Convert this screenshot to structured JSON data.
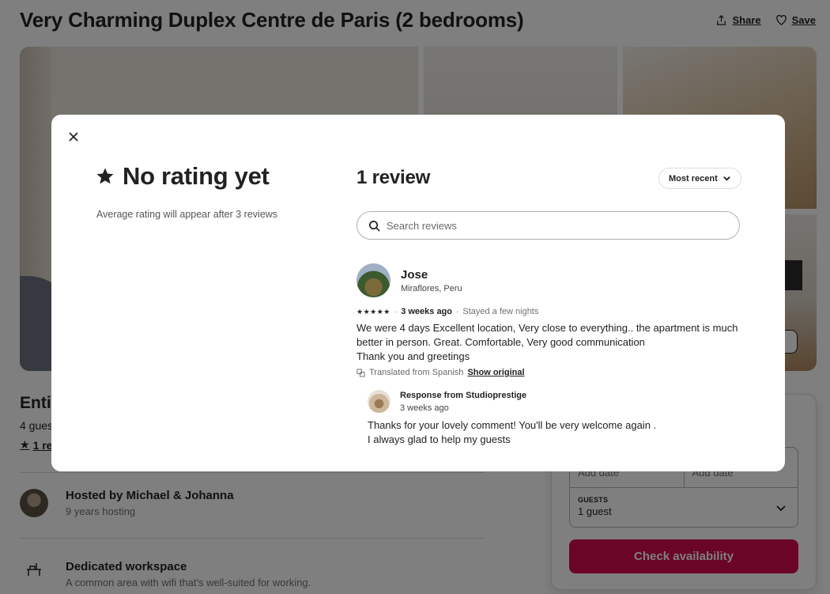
{
  "listing": {
    "title": "Very Charming Duplex Centre de Paris (2 bedrooms)",
    "share_label": "Share",
    "save_label": "Save",
    "type_partial": "Entir",
    "guests_partial": "4 gues",
    "review_link_partial": "1 re",
    "host": {
      "title": "Hosted by Michael & Johanna",
      "subtitle": "9 years hosting"
    },
    "workspace": {
      "title": "Dedicated workspace",
      "subtitle": "A common area with wifi that's well-suited for working."
    }
  },
  "booking": {
    "checkin_placeholder": "Add date",
    "checkout_placeholder": "Add date",
    "guests_label": "GUESTS",
    "guests_value": "1 guest",
    "check_button": "Check availability",
    "accent_color": "#d50b51"
  },
  "modal": {
    "rating_title": "No rating yet",
    "rating_subtitle": "Average rating will appear after 3 reviews",
    "review_count": "1 review",
    "sort_label": "Most recent",
    "search_placeholder": "Search reviews",
    "review": {
      "name": "Jose",
      "location": "Miraflores, Peru",
      "stars": "★★★★★",
      "rating_value": 5,
      "when": "3 weeks ago",
      "stay": "Stayed a few nights",
      "text": "We were 4 days Excellent location, Very close to everything.. the apartment is much\nbetter in person. Great. Comfortable, Very good communication\nThank you and greetings",
      "translated_note": "Translated from Spanish",
      "show_original": "Show original",
      "response": {
        "from": "Response from Studioprestige",
        "when": "3 weeks ago",
        "text": "Thanks for your lovely comment! You'll be very welcome again .\nI always glad to help my guests"
      }
    }
  }
}
